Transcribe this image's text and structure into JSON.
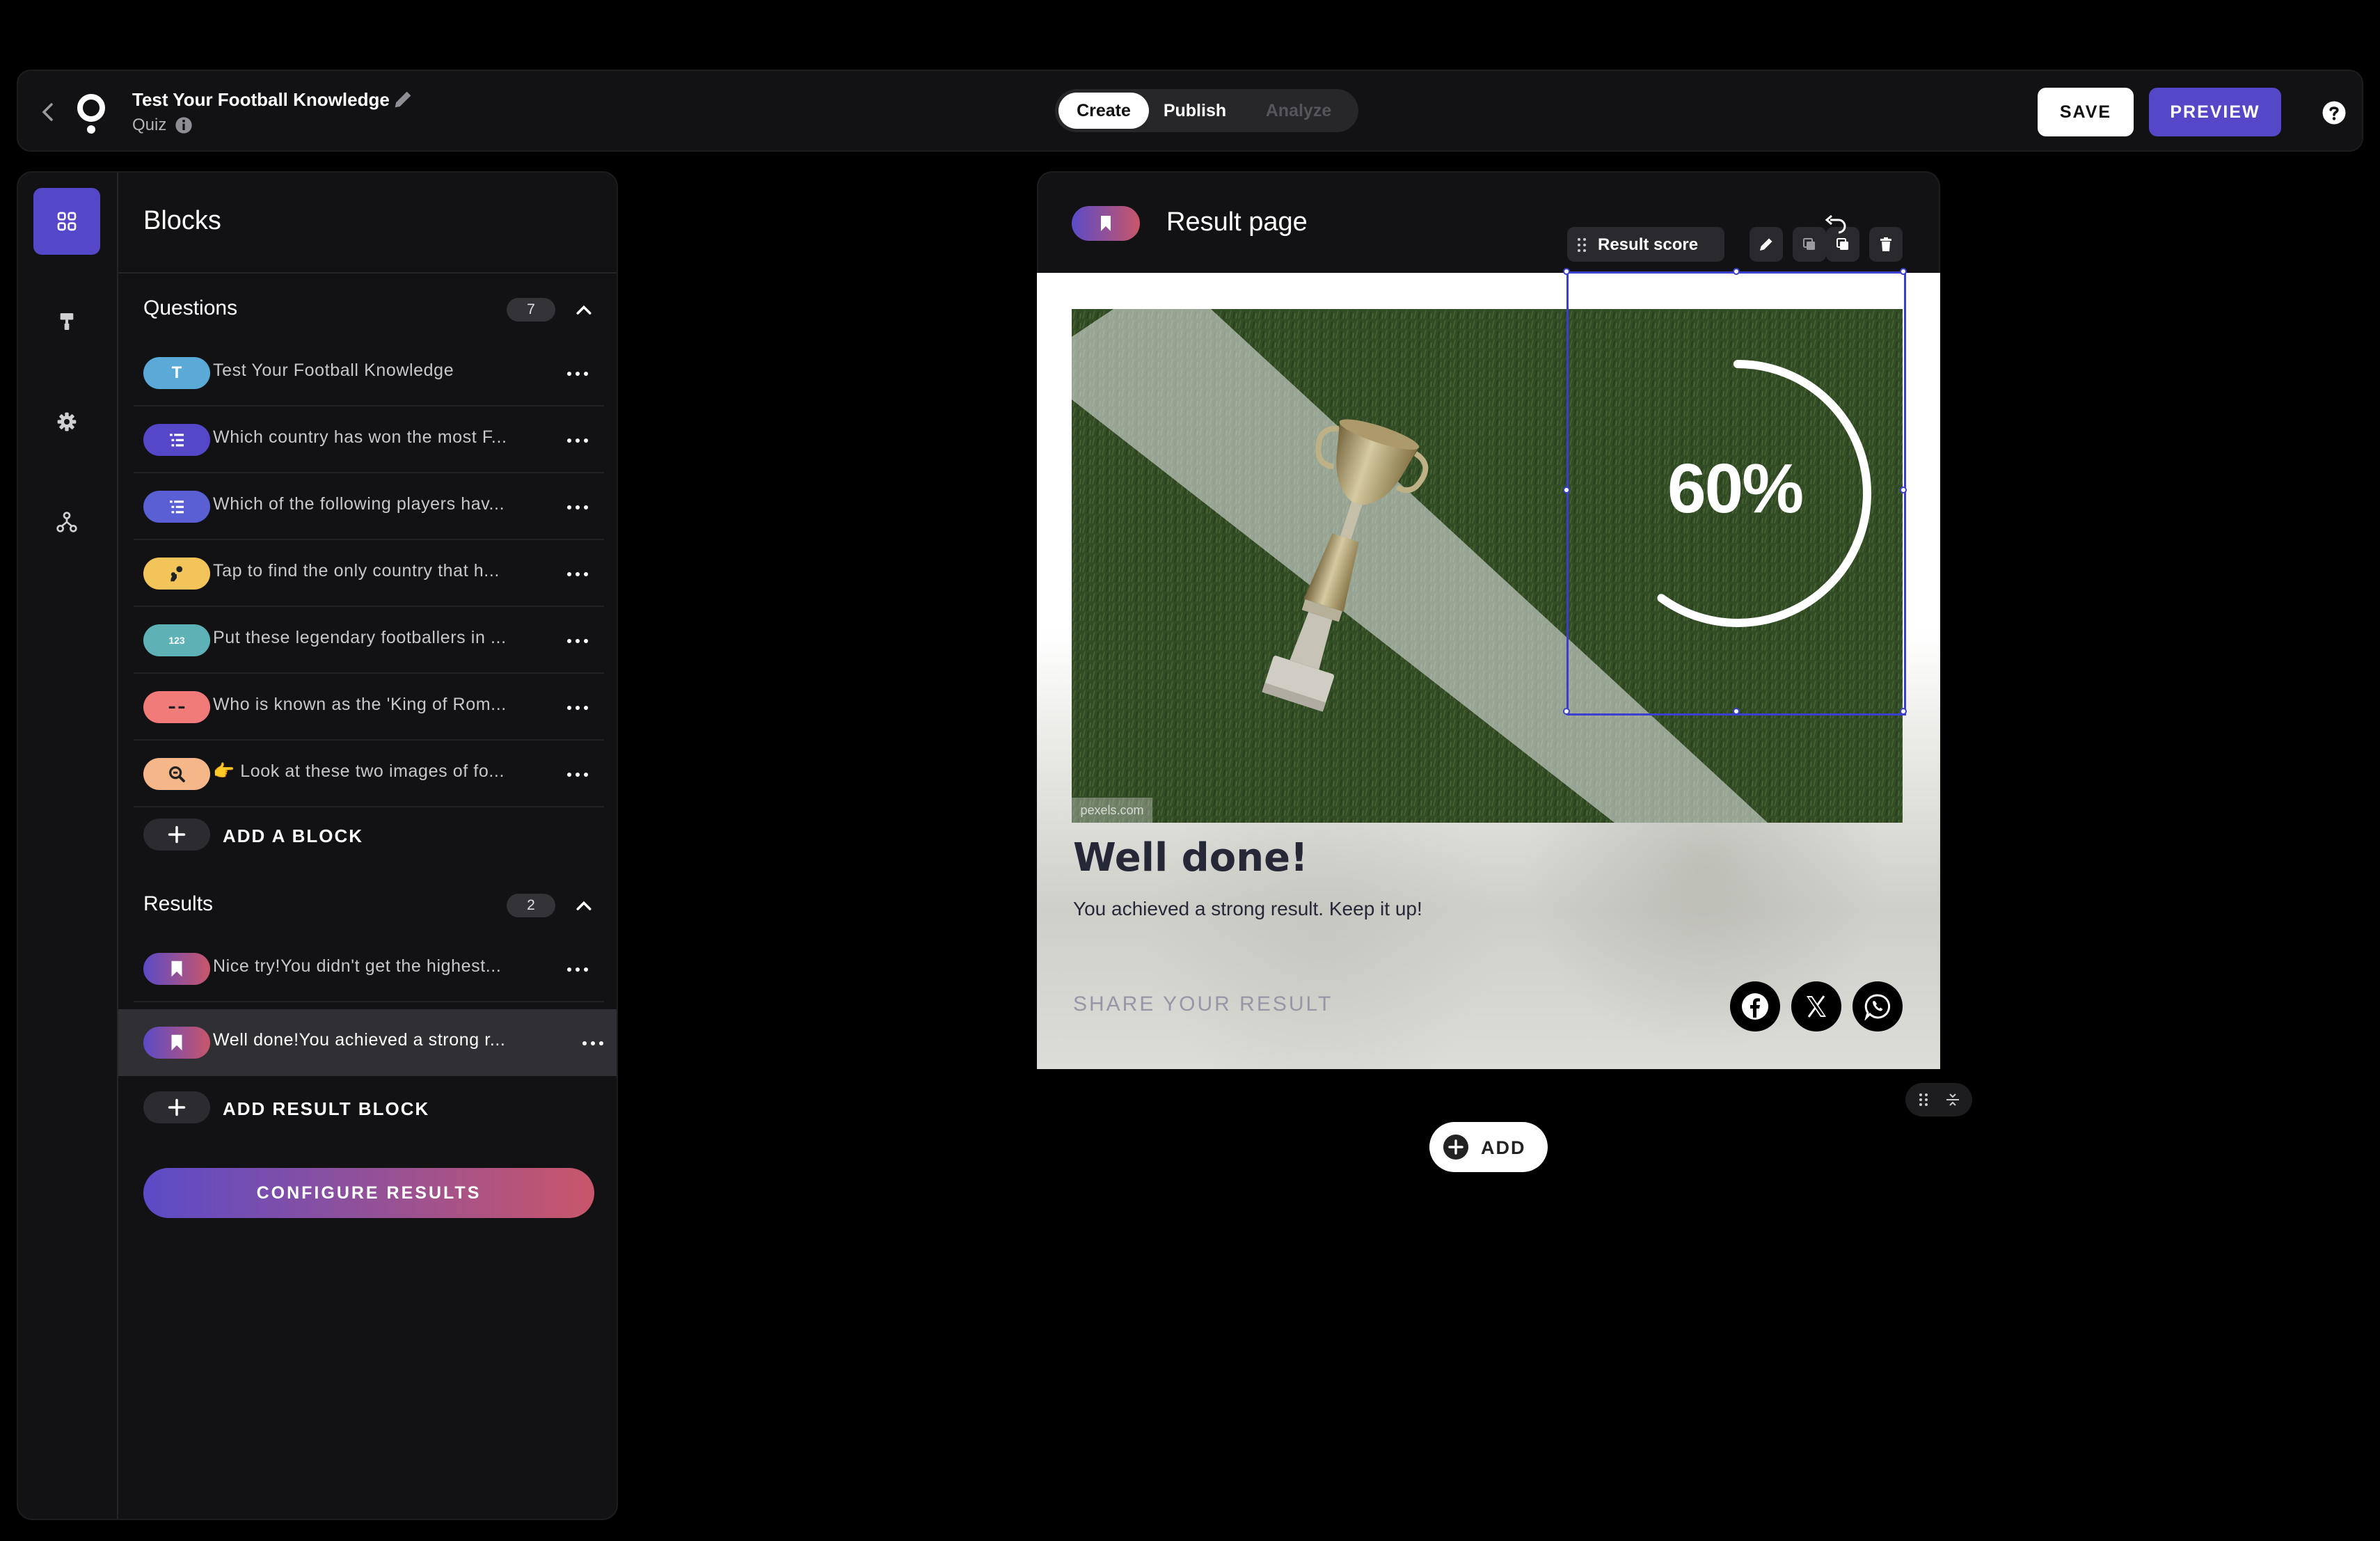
{
  "header": {
    "title": "Test Your Football Knowledge",
    "type_label": "Quiz",
    "tabs": [
      {
        "label": "Create",
        "state": "active"
      },
      {
        "label": "Publish",
        "state": "enabled"
      },
      {
        "label": "Analyze",
        "state": "disabled"
      }
    ],
    "save_label": "SAVE",
    "preview_label": "PREVIEW"
  },
  "rail": {
    "items": [
      {
        "icon": "blocks-grid-icon",
        "active": true
      },
      {
        "icon": "paint-roller-icon",
        "active": false
      },
      {
        "icon": "gear-icon",
        "active": false
      },
      {
        "icon": "flow-icon",
        "active": false
      }
    ]
  },
  "sidebar": {
    "title": "Blocks",
    "questions": {
      "label": "Questions",
      "count": "7",
      "items": [
        {
          "label": "Test Your Football Knowledge",
          "icon": "text-block-icon",
          "color": "#5aa9d6"
        },
        {
          "label": "Which country has won the most F...",
          "icon": "list-icon",
          "color": "#5548c8"
        },
        {
          "label": "Which of the following players hav...",
          "icon": "list-icon",
          "color": "#5a5fd4"
        },
        {
          "label": "Tap to find the only country that h...",
          "icon": "hotspot-icon",
          "color": "#f2c45a"
        },
        {
          "label": "Put these legendary footballers in ...",
          "icon": "order-icon",
          "color": "#5eb2b6"
        },
        {
          "label": "Who is known as the 'King of Rom...",
          "icon": "fill-blank-icon",
          "color": "#f07b79"
        },
        {
          "label": "👉 Look at these two images of fo...",
          "icon": "magnifier-icon",
          "color": "#f5b68a"
        }
      ],
      "add_label": "ADD A BLOCK"
    },
    "results": {
      "label": "Results",
      "count": "2",
      "items": [
        {
          "label": "Nice try!You didn't get the highest...",
          "icon": "bookmark-icon"
        },
        {
          "label": "Well done!You achieved a strong r...",
          "icon": "bookmark-icon",
          "selected": true
        }
      ],
      "add_label": "ADD RESULT BLOCK"
    },
    "configure_label": "CONFIGURE RESULTS"
  },
  "canvas": {
    "page_title": "Result page",
    "toolbar_label": "Result score",
    "score": "60%",
    "score_fraction": 0.6,
    "image_credit": "pexels.com",
    "result_title": "Well done!",
    "result_desc": "You achieved a strong result. Keep it up!",
    "share_label": "SHARE YOUR RESULT",
    "share_icons": [
      "facebook-icon",
      "x-icon",
      "whatsapp-icon"
    ],
    "add_label": "ADD"
  },
  "colors": {
    "accent": "#5548c8",
    "gradient_end": "#c9566a",
    "selection": "#3b3fd0"
  }
}
